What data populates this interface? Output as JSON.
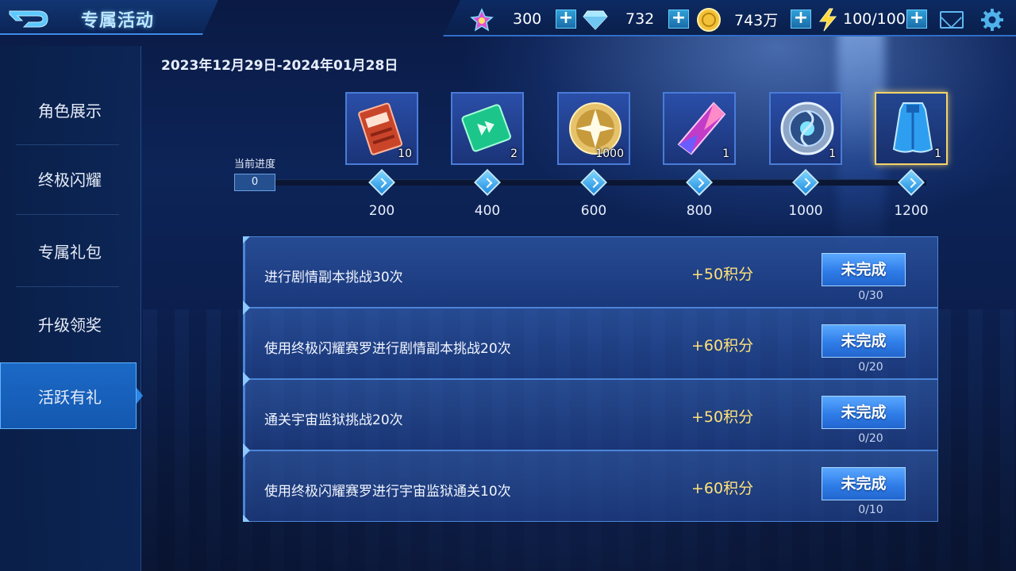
{
  "header": {
    "title": "专属活动",
    "resources": [
      {
        "name": "star",
        "value": "300"
      },
      {
        "name": "diamond",
        "value": "732"
      },
      {
        "name": "gold",
        "value": "743万"
      },
      {
        "name": "energy",
        "value": "100/100"
      }
    ],
    "plus_label": "+"
  },
  "sidebar": {
    "items": [
      {
        "label": "角色展示",
        "active": false
      },
      {
        "label": "终极闪耀",
        "active": false
      },
      {
        "label": "专属礼包",
        "active": false
      },
      {
        "label": "升级领奖",
        "active": false
      },
      {
        "label": "活跃有礼",
        "active": true
      }
    ]
  },
  "event": {
    "date_range": "2023年12月29日-2024年01月28日",
    "progress_label": "当前进度",
    "progress_value": "0",
    "milestones": [
      "200",
      "400",
      "600",
      "800",
      "1000",
      "1200"
    ],
    "rewards": [
      {
        "icon": "exp-ticket-icon",
        "qty": "10"
      },
      {
        "icon": "green-card-icon",
        "qty": "2"
      },
      {
        "icon": "gold-medal-icon",
        "qty": "1000"
      },
      {
        "icon": "crystal-icon",
        "qty": "1"
      },
      {
        "icon": "silver-emblem-icon",
        "qty": "1"
      },
      {
        "icon": "blue-cape-icon",
        "qty": "1"
      }
    ]
  },
  "tasks": [
    {
      "desc": "进行剧情副本挑战30次",
      "points": "+50积分",
      "button": "未完成",
      "count": "0/30"
    },
    {
      "desc": "使用终极闪耀赛罗进行剧情副本挑战20次",
      "points": "+60积分",
      "button": "未完成",
      "count": "0/20"
    },
    {
      "desc": "通关宇宙监狱挑战20次",
      "points": "+50积分",
      "button": "未完成",
      "count": "0/20"
    },
    {
      "desc": "使用终极闪耀赛罗进行宇宙监狱通关10次",
      "points": "+60积分",
      "button": "未完成",
      "count": "0/10"
    }
  ]
}
